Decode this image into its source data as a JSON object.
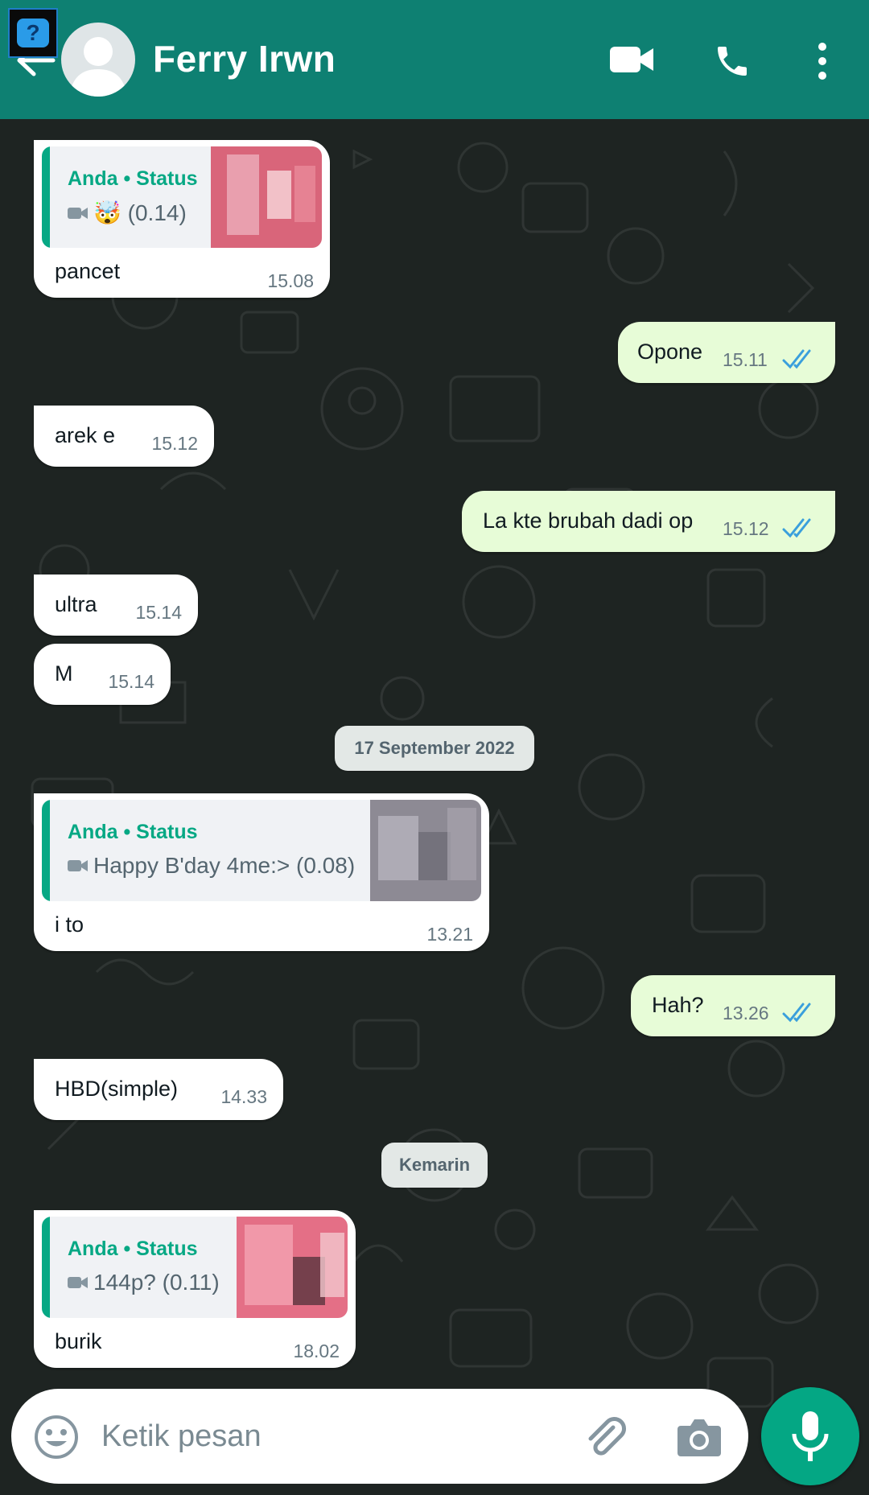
{
  "header": {
    "contact_name": "Ferry Irwn",
    "background_color": "#0e8072",
    "icons": [
      "back-arrow-icon",
      "avatar",
      "video-call-icon",
      "phone-icon",
      "more-options-icon"
    ]
  },
  "overlay_badge": {
    "glyph": "?"
  },
  "messages": [
    {
      "dir": "in",
      "quote": {
        "author": "Anda • Status",
        "media_icon": "video-icon",
        "text": "🤯 (0.14)"
      },
      "text": "pancet",
      "time": "15.08"
    },
    {
      "dir": "out",
      "text": "Opone",
      "time": "15.11",
      "ticks": "read"
    },
    {
      "dir": "in",
      "text": "arek e",
      "time": "15.12"
    },
    {
      "dir": "out",
      "text": "La kte brubah dadi op",
      "time": "15.12",
      "ticks": "read"
    },
    {
      "dir": "in",
      "text": "ultra",
      "time": "15.14"
    },
    {
      "dir": "in",
      "text": "M",
      "time": "15.14"
    },
    {
      "dir": "in",
      "quote": {
        "author": "Anda • Status",
        "media_icon": "video-icon",
        "text": "Happy B'day 4me:> (0.08)"
      },
      "text": "i to",
      "time": "13.21"
    },
    {
      "dir": "out",
      "text": "Hah?",
      "time": "13.26",
      "ticks": "read"
    },
    {
      "dir": "in",
      "text": "HBD(simple)",
      "time": "14.33"
    },
    {
      "dir": "in",
      "quote": {
        "author": "Anda • Status",
        "media_icon": "video-icon",
        "text": "144p? (0.11)"
      },
      "text": "burik",
      "time": "18.02"
    }
  ],
  "date_separators": [
    "17 September 2022",
    "Kemarin"
  ],
  "composer": {
    "placeholder": "Ketik pesan",
    "icons": [
      "emoji-icon",
      "attach-icon",
      "camera-icon",
      "mic-icon"
    ]
  },
  "colors": {
    "incoming_bubble": "#ffffff",
    "outgoing_bubble": "#e7fcd7",
    "accent": "#06a884",
    "read_ticks": "#3a9fdc",
    "wallpaper": "#1e2422"
  }
}
